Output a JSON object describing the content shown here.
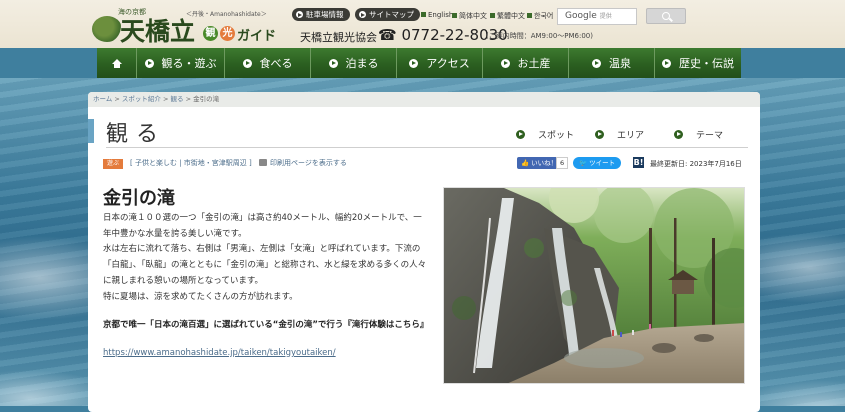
{
  "header": {
    "logo_tagline": "海の京都",
    "logo_region": "＜丹後・Amanohashidate＞",
    "logo_title": "天橋立",
    "logo_badge_1": "観",
    "logo_badge_2": "光",
    "logo_guide": "ガイド",
    "association": "天橋立観光協会",
    "phone": "☎ 0772-22-8030",
    "hours": "(ご案内時間：AM9:00〜PM6:00)",
    "pills": [
      "駐車場情報",
      "サイトマップ"
    ],
    "languages": [
      "English",
      "简体中文",
      "繁體中文",
      "한국어"
    ],
    "search_brand": "Google",
    "search_hint": "提供"
  },
  "nav": {
    "items": [
      "観る・遊ぶ",
      "食べる",
      "泊まる",
      "アクセス",
      "お土産",
      "温泉",
      "歴史・伝説"
    ]
  },
  "breadcrumb": {
    "home": "ホーム",
    "sep": " > ",
    "spot": "スポット紹介",
    "section": "観る",
    "current": "金引の滝"
  },
  "page": {
    "title": "観る",
    "categories": [
      "スポット",
      "エリア",
      "テーマ"
    ],
    "tag_badge": "遊ぶ",
    "tags": "[ 子供と楽しむ | 市街地・宮津駅周辺 ]",
    "print": "印刷用ページを表示する",
    "fb_like": "👍 いいね！",
    "fb_count": "6",
    "tweet": "🐦 ツイート",
    "hatena": "B!",
    "updated": "最終更新日: 2023年7月16日"
  },
  "spot": {
    "name": "金引の滝",
    "paragraphs": [
      "日本の滝１００選の一つ「金引の滝」は高さ約40メートル、幅約20メートルで、一年中豊かな水量を誇る美しい滝です。",
      "水は左右に流れて落ち、右側は「男滝」、左側は「女滝」と呼ばれています。下流の「白龍」、「臥龍」の滝とともに「金引の滝」と総称され、水と緑を求める多くの人々に親しまれる憩いの場所となっています。",
      "特に夏場は、涼を求めてたくさんの方が訪れます。"
    ],
    "promo": "京都で唯一「日本の滝百選」に選ばれている“金引の滝”で行う『滝行体験はこちら』",
    "url": "https://www.amanohashidate.jp/taiken/takigyoutaiken/"
  },
  "colors": {
    "nav_green": "#2b5f20",
    "badge_orange": "#e47b3c",
    "badge_green": "#4a8a2a",
    "link_blue": "#4b6c8a",
    "accent_blue": "#6aa4c4"
  }
}
